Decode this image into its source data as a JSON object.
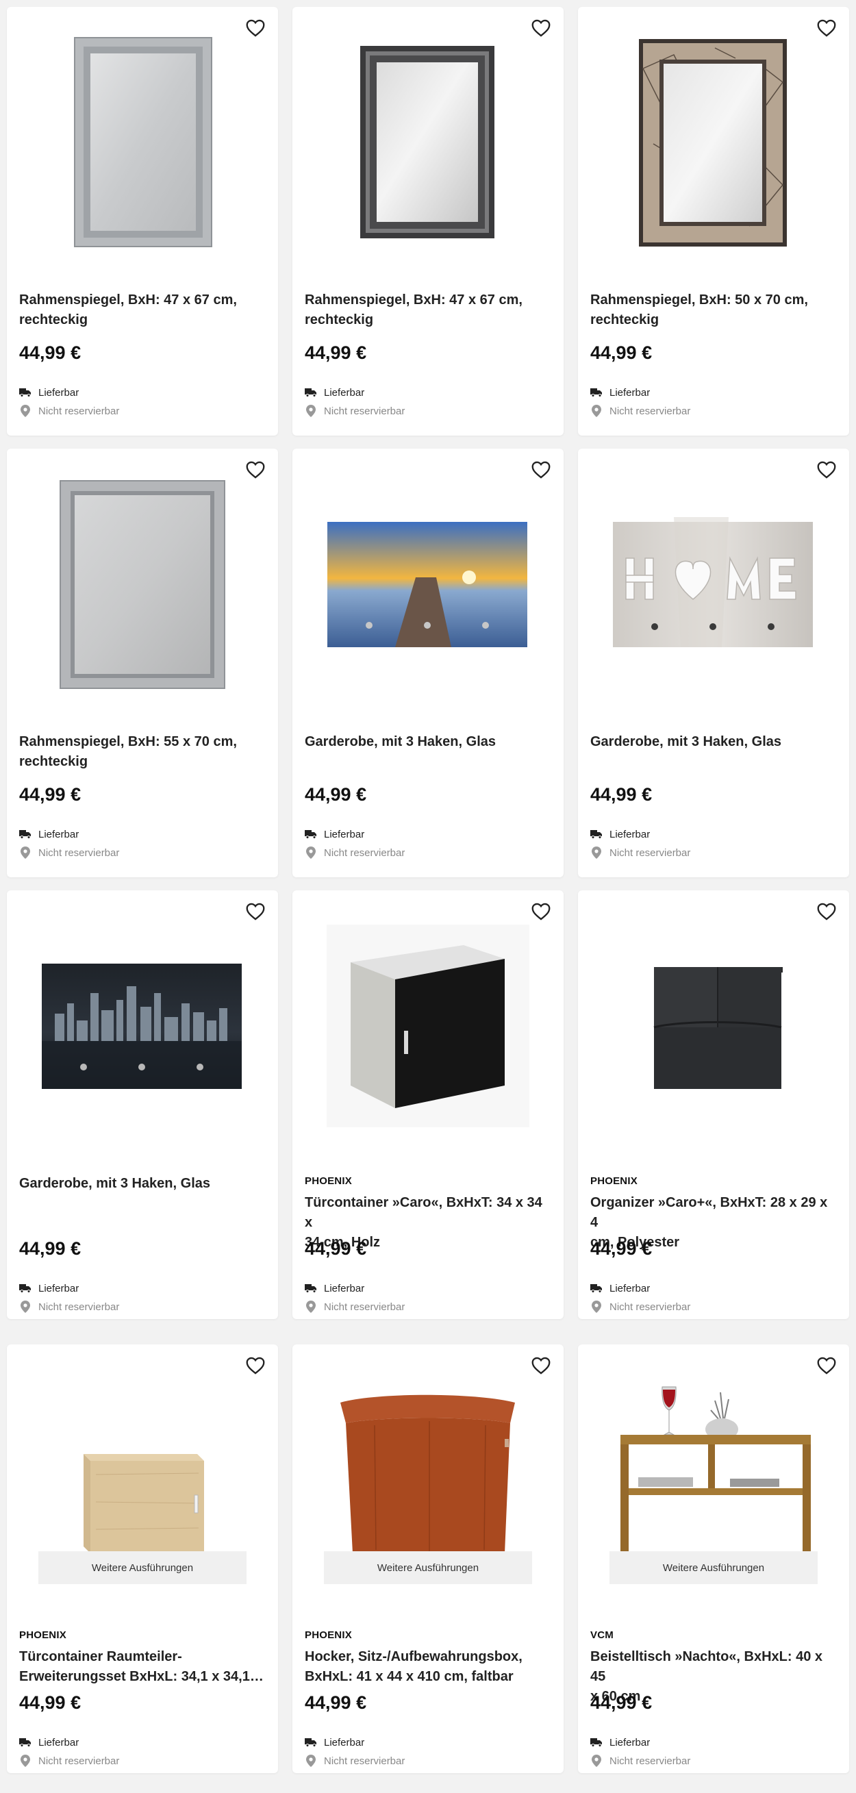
{
  "products": [
    {
      "brand": "",
      "title_lines": [
        "Rahmenspiegel, BxH: 47 x 67 cm,",
        "rechteckig"
      ],
      "price": "44,99 €",
      "availability": "Lieferbar",
      "reservation": "Nicht reservierbar",
      "image": "silver-frame-mirror"
    },
    {
      "brand": "",
      "title_lines": [
        "Rahmenspiegel, BxH: 47 x 67 cm,",
        "rechteckig"
      ],
      "price": "44,99 €",
      "availability": "Lieferbar",
      "reservation": "Nicht reservierbar",
      "image": "black-silver-frame-mirror"
    },
    {
      "brand": "",
      "title_lines": [
        "Rahmenspiegel, BxH: 50 x 70 cm,",
        "rechteckig"
      ],
      "price": "44,99 €",
      "availability": "Lieferbar",
      "reservation": "Nicht reservierbar",
      "image": "bronze-frame-mirror"
    },
    {
      "brand": "",
      "title_lines": [
        "Rahmenspiegel, BxH: 55 x 70 cm,",
        "rechteckig"
      ],
      "price": "44,99 €",
      "availability": "Lieferbar",
      "reservation": "Nicht reservierbar",
      "image": "glitter-frame-mirror"
    },
    {
      "brand": "",
      "title_lines": [
        "Garderobe, mit 3 Haken, Glas"
      ],
      "price": "44,99 €",
      "availability": "Lieferbar",
      "reservation": "Nicht reservierbar",
      "image": "sunset-pier-coat-rack"
    },
    {
      "brand": "",
      "title_lines": [
        "Garderobe, mit 3 Haken, Glas"
      ],
      "price": "44,99 €",
      "availability": "Lieferbar",
      "reservation": "Nicht reservierbar",
      "image": "home-coat-rack"
    },
    {
      "brand": "",
      "title_lines": [
        "Garderobe, mit 3 Haken, Glas"
      ],
      "price": "44,99 €",
      "availability": "Lieferbar",
      "reservation": "Nicht reservierbar",
      "image": "city-skyline-coat-rack"
    },
    {
      "brand": "PHOENIX",
      "title_lines": [
        "Türcontainer »Caro«, BxHxT: 34 x 34 x",
        "34 cm, Holz"
      ],
      "price": "44,99 €",
      "availability": "Lieferbar",
      "reservation": "Nicht reservierbar",
      "image": "door-container-black"
    },
    {
      "brand": "PHOENIX",
      "title_lines": [
        "Organizer »Caro+«, BxHxT: 28 x 29 x 4",
        "cm, Polyester"
      ],
      "price": "44,99 €",
      "availability": "Lieferbar",
      "reservation": "Nicht reservierbar",
      "image": "hanging-organizer"
    },
    {
      "brand": "PHOENIX",
      "title_lines": [
        "Türcontainer Raumteiler-",
        "Erweiterungsset BxHxL: 34,1 x 34,1 x…"
      ],
      "price": "44,99 €",
      "availability": "Lieferbar",
      "reservation": "Nicht reservierbar",
      "variants": "Weitere Ausführungen",
      "image": "oak-container"
    },
    {
      "brand": "PHOENIX",
      "title_lines": [
        "Hocker, Sitz-/Aufbewahrungsbox,",
        "BxHxL: 41 x 44 x 410 cm, faltbar"
      ],
      "price": "44,99 €",
      "availability": "Lieferbar",
      "reservation": "Nicht reservierbar",
      "variants": "Weitere Ausführungen",
      "image": "orange-storage-stool"
    },
    {
      "brand": "VCM",
      "title_lines": [
        "Beistelltisch »Nachto«, BxHxL: 40 x 45",
        "x 60 cm"
      ],
      "price": "44,99 €",
      "availability": "Lieferbar",
      "reservation": "Nicht reservierbar",
      "variants": "Weitere Ausführungen",
      "image": "side-table"
    }
  ],
  "icons": {
    "favorite": "heart-outline-icon",
    "delivery": "truck-icon",
    "location": "location-pin-icon"
  },
  "colors": {
    "background": "#f2f2f2",
    "card": "#ffffff",
    "text": "#222222",
    "muted": "#888888",
    "variants_bg": "#f0f0f0"
  }
}
